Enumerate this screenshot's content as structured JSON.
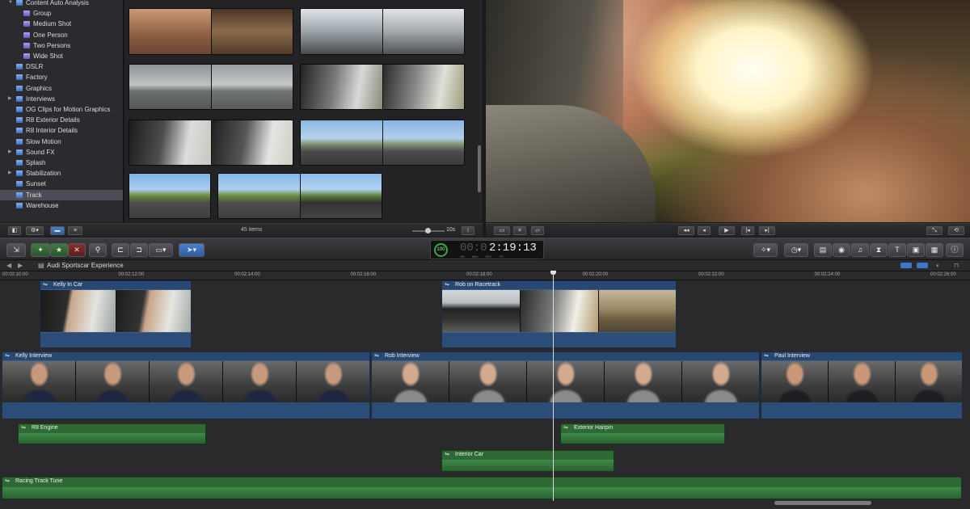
{
  "library": {
    "items": [
      {
        "label": "Content Auto Analysis",
        "type": "keyword-group"
      },
      {
        "label": "Group",
        "type": "keyword"
      },
      {
        "label": "Medium Shot",
        "type": "keyword"
      },
      {
        "label": "One Person",
        "type": "keyword"
      },
      {
        "label": "Two Persons",
        "type": "keyword"
      },
      {
        "label": "Wide Shot",
        "type": "keyword"
      },
      {
        "label": "DSLR",
        "type": "event"
      },
      {
        "label": "Factory",
        "type": "event"
      },
      {
        "label": "Graphics",
        "type": "event"
      },
      {
        "label": "Interviews",
        "type": "folder"
      },
      {
        "label": "OG Clips for Motion Graphics",
        "type": "event"
      },
      {
        "label": "R8 Exterior Details",
        "type": "event"
      },
      {
        "label": "R8 Interior Details",
        "type": "event"
      },
      {
        "label": "Slow Motion",
        "type": "event"
      },
      {
        "label": "Sound FX",
        "type": "folder"
      },
      {
        "label": "Splash",
        "type": "event"
      },
      {
        "label": "Stabilization",
        "type": "folder"
      },
      {
        "label": "Sunset",
        "type": "event"
      },
      {
        "label": "Track",
        "type": "event",
        "selected": true
      },
      {
        "label": "Warehouse",
        "type": "event"
      }
    ]
  },
  "browser": {
    "item_count": "45 items",
    "duration": "10s"
  },
  "timecode": {
    "value": "2:19:13",
    "prefix": "00:0",
    "indicator": "100",
    "labels": [
      "HR",
      "MIN",
      "SEC",
      "FR"
    ]
  },
  "timeline": {
    "project_title": "Audi Sportscar Experience",
    "ruler_ticks": [
      "00:02:10:00",
      "00:02:12:00",
      "00:02:14:00",
      "00:02:16:00",
      "00:02:18:00",
      "00:02:20:00",
      "00:02:22:00",
      "00:02:24:00",
      "00:02:26:00"
    ],
    "clips": {
      "kelly_in_car": "Kelly In Car",
      "rob_on_racetrack": "Rob on Racetrack",
      "kelly_interview": "Kelly Interview",
      "rob_interview": "Rob Interview",
      "paul_interview": "Paul Interview",
      "r8_engine": "R8 Engine",
      "exterior_hairpin": "Exterior Hairpin",
      "interior_car": "Interior Car",
      "racing_track_tune": "Racing Track Tune"
    }
  },
  "colors": {
    "video_clip": "#3a5f8c",
    "audio_clip": "#2f6a36",
    "selection": "#4a4d56"
  },
  "icons": [
    "library-toggle-icon",
    "gear-icon",
    "filmstrip-view-icon",
    "list-view-icon",
    "import-icon",
    "keyword-icon",
    "key-icon",
    "append-icon",
    "select-tool-icon",
    "play-icon",
    "previous-icon",
    "next-icon",
    "camera-icon",
    "music-icon",
    "title-icon",
    "generator-icon",
    "theme-icon",
    "info-icon"
  ]
}
